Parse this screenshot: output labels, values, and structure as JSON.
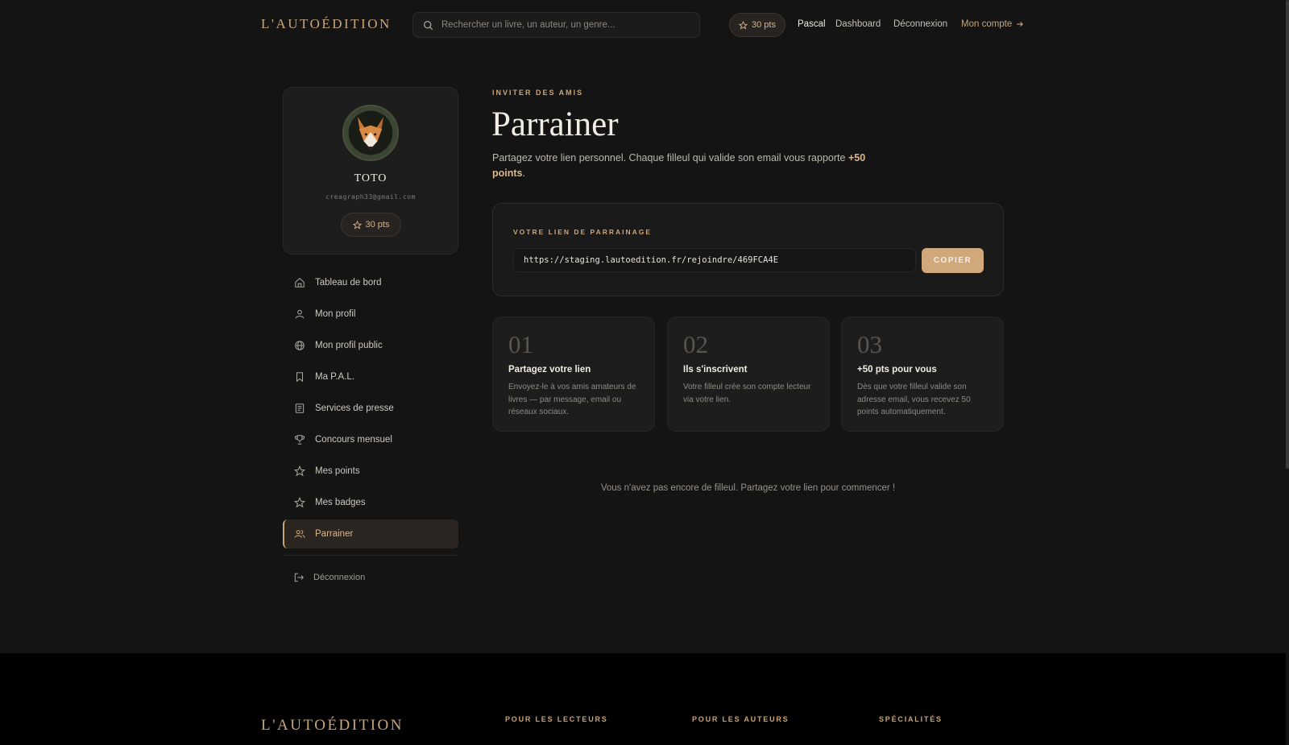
{
  "header": {
    "logo": "L'AUTOÉDITION",
    "search_placeholder": "Rechercher un livre, un auteur, un genre...",
    "points": "30 pts",
    "nav": {
      "user": "Pascal",
      "dashboard": "Dashboard",
      "logout": "Déconnexion",
      "account": "Mon compte"
    }
  },
  "profile": {
    "name": "TOTO",
    "email": "creagraph33@gmail.com",
    "points": "30 pts"
  },
  "sidebar": {
    "items": [
      {
        "label": "Tableau de bord",
        "icon": "home-icon"
      },
      {
        "label": "Mon profil",
        "icon": "user-icon"
      },
      {
        "label": "Mon profil public",
        "icon": "globe-icon"
      },
      {
        "label": "Ma P.A.L.",
        "icon": "bookmark-icon"
      },
      {
        "label": "Services de presse",
        "icon": "newspaper-icon"
      },
      {
        "label": "Concours mensuel",
        "icon": "trophy-icon"
      },
      {
        "label": "Mes points",
        "icon": "star-icon"
      },
      {
        "label": "Mes badges",
        "icon": "star-icon"
      },
      {
        "label": "Parrainer",
        "icon": "users-icon",
        "active": true
      }
    ],
    "logout": "Déconnexion"
  },
  "main": {
    "eyebrow": "INVITER DES AMIS",
    "title": "Parrainer",
    "intro": "Partagez votre lien personnel. Chaque filleul qui valide son email vous rapporte ",
    "intro_highlight": "+50 points",
    "intro_end": ".",
    "link_card": {
      "label": "VOTRE LIEN DE PARRAINAGE",
      "url": "https://staging.lautoedition.fr/rejoindre/469FCA4E",
      "copy_button": "COPIER"
    },
    "steps": [
      {
        "number": "01",
        "title": "Partagez votre lien",
        "text": "Envoyez-le à vos amis amateurs de livres — par message, email ou réseaux sociaux."
      },
      {
        "number": "02",
        "title": "Ils s'inscrivent",
        "text": "Votre filleul crée son compte lecteur via votre lien."
      },
      {
        "number": "03",
        "title": "+50 pts pour vous",
        "text": "Dès que votre filleul valide son adresse email, vous recevez 50 points automatiquement."
      }
    ],
    "empty_message": "Vous n'avez pas encore de filleul. Partagez votre lien pour commencer !"
  },
  "footer": {
    "logo": "L'AUTOÉDITION",
    "columns": [
      "POUR LES LECTEURS",
      "POUR LES AUTEURS",
      "SPÉCIALITÉS"
    ]
  },
  "colors": {
    "background": "#141414",
    "accent": "#c9a57a",
    "button": "#d1a77c"
  }
}
